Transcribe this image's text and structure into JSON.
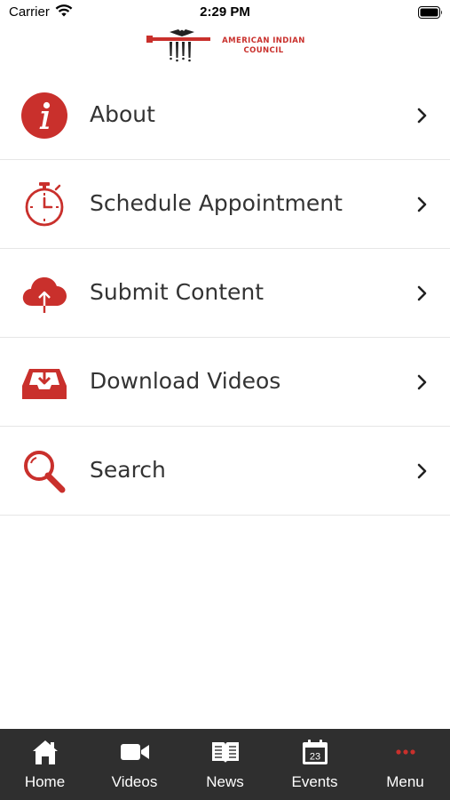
{
  "status_bar": {
    "carrier": "Carrier",
    "time": "2:29 PM"
  },
  "header": {
    "logo_line1": "AMERICAN INDIAN",
    "logo_line2": "COUNCIL"
  },
  "menu": {
    "items": [
      {
        "label": "About",
        "icon": "info-icon"
      },
      {
        "label": "Schedule Appointment",
        "icon": "stopwatch-icon"
      },
      {
        "label": "Submit Content",
        "icon": "cloud-upload-icon"
      },
      {
        "label": "Download Videos",
        "icon": "download-tray-icon"
      },
      {
        "label": "Search",
        "icon": "search-icon"
      }
    ]
  },
  "tab_bar": {
    "tabs": [
      {
        "label": "Home",
        "icon": "home-icon"
      },
      {
        "label": "Videos",
        "icon": "video-camera-icon"
      },
      {
        "label": "News",
        "icon": "book-icon"
      },
      {
        "label": "Events",
        "icon": "calendar-icon",
        "calendar_day": "23"
      },
      {
        "label": "Menu",
        "icon": "more-dots-icon"
      }
    ]
  },
  "colors": {
    "accent": "#c9302c",
    "text": "#333333",
    "divider": "#e6e6e6",
    "tab_bar": "#2f2f2f",
    "tab_text": "#ffffff"
  }
}
